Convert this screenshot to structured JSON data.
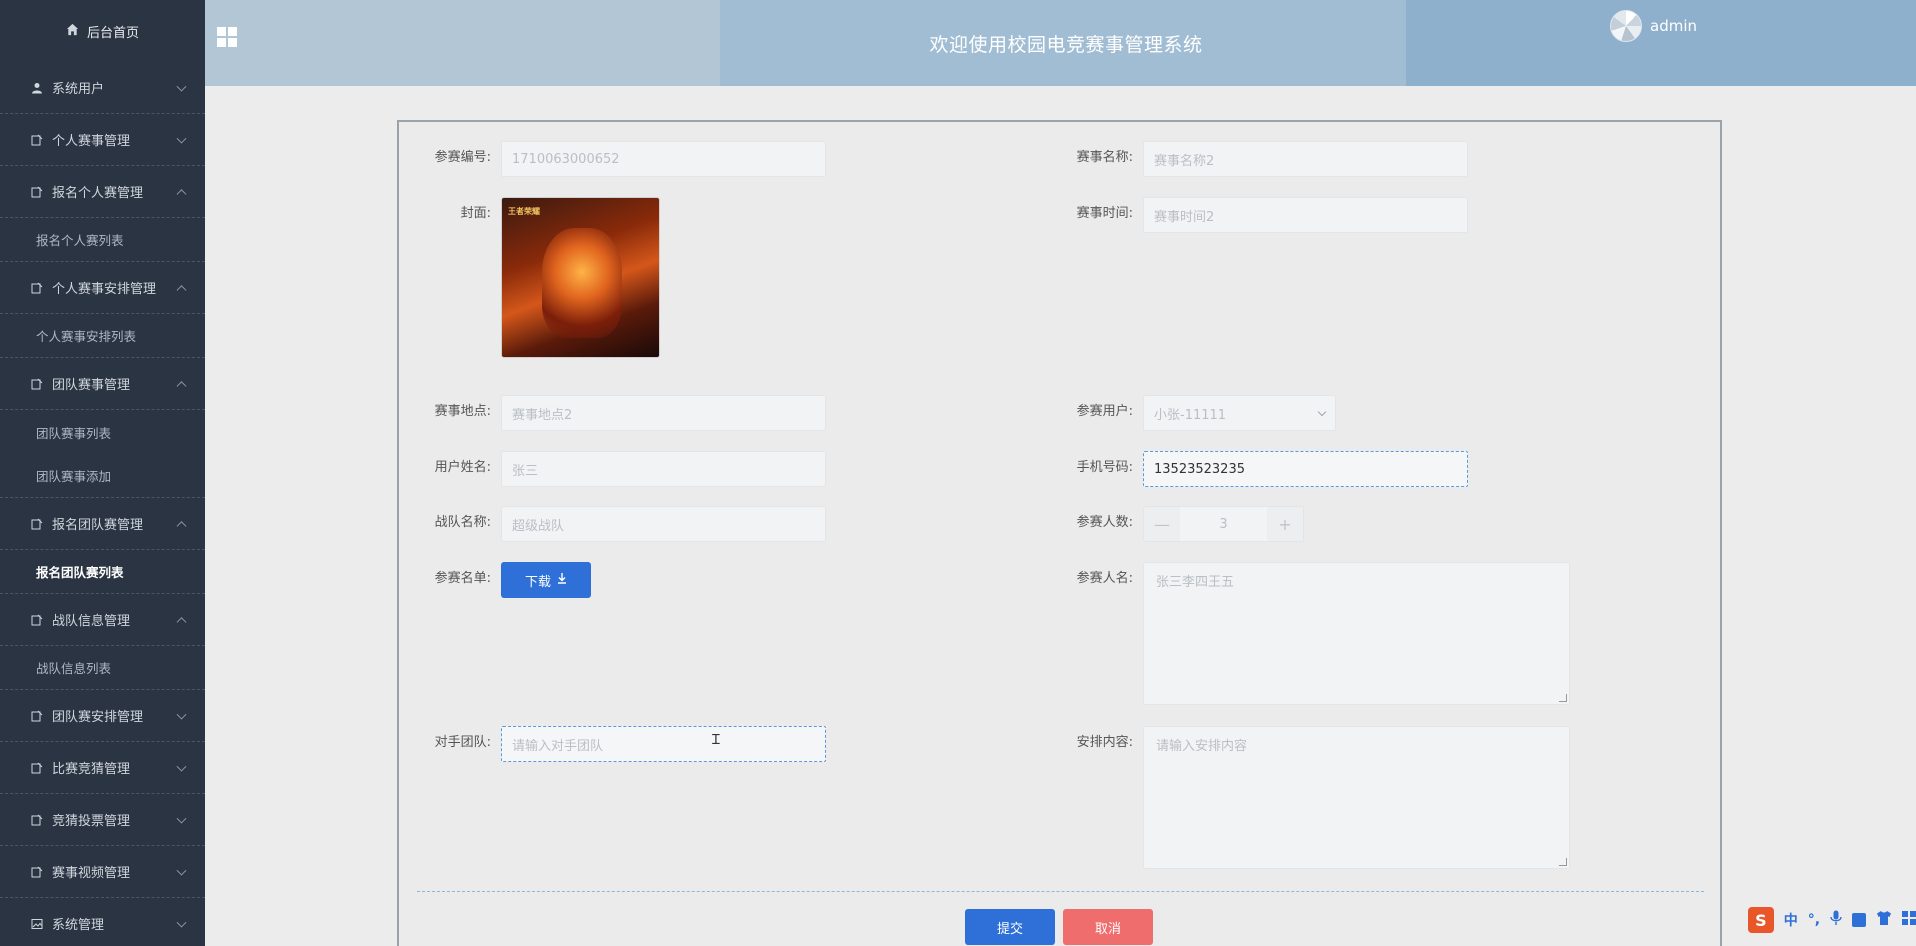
{
  "sidebar": {
    "home": "后台首页",
    "items": [
      {
        "label": "系统用户",
        "expanded": false
      },
      {
        "label": "个人赛事管理",
        "expanded": false
      },
      {
        "label": "报名个人赛管理",
        "expanded": true,
        "sub": [
          "报名个人赛列表"
        ]
      },
      {
        "label": "个人赛事安排管理",
        "expanded": true,
        "sub": [
          "个人赛事安排列表"
        ]
      },
      {
        "label": "团队赛事管理",
        "expanded": true,
        "sub": [
          "团队赛事列表",
          "团队赛事添加"
        ]
      },
      {
        "label": "报名团队赛管理",
        "expanded": true,
        "sub": [
          "报名团队赛列表"
        ]
      },
      {
        "label": "战队信息管理",
        "expanded": true,
        "sub": [
          "战队信息列表"
        ]
      },
      {
        "label": "团队赛安排管理",
        "expanded": false
      },
      {
        "label": "比赛竞猜管理",
        "expanded": false
      },
      {
        "label": "竞猜投票管理",
        "expanded": false
      },
      {
        "label": "赛事视频管理",
        "expanded": false
      },
      {
        "label": "系统管理",
        "expanded": false
      }
    ]
  },
  "header": {
    "title": "欢迎使用校园电竞赛事管理系统",
    "user": "admin"
  },
  "form": {
    "entry_no": {
      "label": "参赛编号:",
      "value": "1710063000652"
    },
    "event_name": {
      "label": "赛事名称:",
      "value": "赛事名称2"
    },
    "cover": {
      "label": "封面:",
      "logo_text": "王者荣耀"
    },
    "event_time": {
      "label": "赛事时间:",
      "value": "赛事时间2"
    },
    "event_place": {
      "label": "赛事地点:",
      "value": "赛事地点2"
    },
    "entry_user": {
      "label": "参赛用户:",
      "value": "小张-11111"
    },
    "user_name": {
      "label": "用户姓名:",
      "value": "张三"
    },
    "phone": {
      "label": "手机号码:",
      "value": "13523523235"
    },
    "team_name": {
      "label": "战队名称:",
      "value": "超级战队"
    },
    "member_count": {
      "label": "参赛人数:",
      "value": "3",
      "minus": "—",
      "plus": "+"
    },
    "roster": {
      "label": "参赛名单:",
      "button": "下载"
    },
    "member_names": {
      "label": "参赛人名:",
      "value": "张三李四王五"
    },
    "opponent": {
      "label": "对手团队:",
      "placeholder": "请输入对手团队"
    },
    "arrangement": {
      "label": "安排内容:",
      "placeholder": "请输入安排内容"
    },
    "submit": "提交",
    "cancel": "取消"
  },
  "ime": {
    "logo": "S",
    "mode": "中",
    "punct": "°,"
  }
}
